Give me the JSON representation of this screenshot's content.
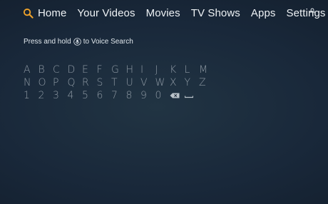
{
  "nav": {
    "items": [
      {
        "label": "Home"
      },
      {
        "label": "Your Videos"
      },
      {
        "label": "Movies"
      },
      {
        "label": "TV Shows"
      },
      {
        "label": "Apps"
      },
      {
        "label": "Settings"
      }
    ],
    "search_icon": "search-icon",
    "accent_color": "#f0a32a"
  },
  "hint": {
    "prefix": "Press and hold",
    "suffix": "to Voice Search",
    "icon": "microphone-icon"
  },
  "keyboard": {
    "row1": [
      "A",
      "B",
      "C",
      "D",
      "E",
      "F",
      "G",
      "H",
      "I",
      "J",
      "K",
      "L",
      "M"
    ],
    "row2": [
      "N",
      "O",
      "P",
      "Q",
      "R",
      "S",
      "T",
      "U",
      "V",
      "W",
      "X",
      "Y",
      "Z"
    ],
    "row3": [
      "1",
      "2",
      "3",
      "4",
      "5",
      "6",
      "7",
      "8",
      "9",
      "0"
    ],
    "backspace_icon": "backspace-icon",
    "space_icon": "space-icon"
  }
}
